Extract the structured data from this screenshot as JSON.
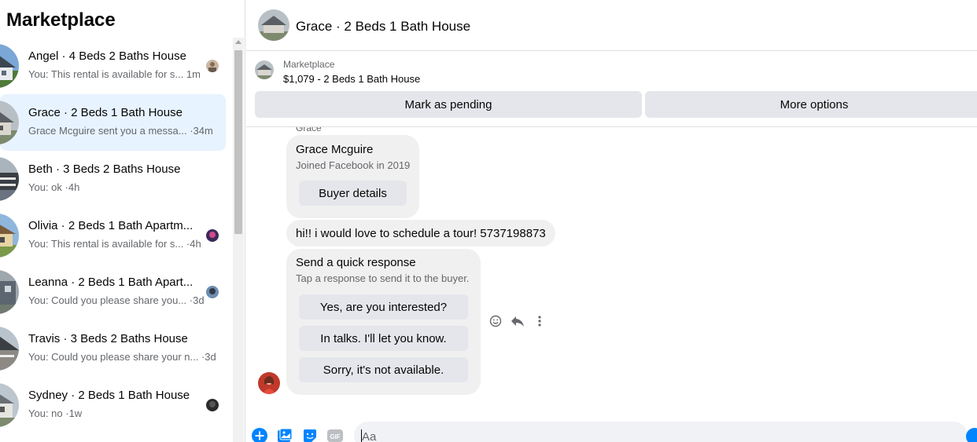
{
  "sidebar": {
    "title": "Marketplace",
    "conversations": [
      {
        "title": "Angel · 4 Beds 2 Baths House",
        "preview": "You: This rental is available for s...",
        "time": "1m",
        "active": false
      },
      {
        "title": "Grace · 2 Beds 1 Bath House",
        "preview": "Grace Mcguire sent you a messa...",
        "time": "·34m",
        "active": true
      },
      {
        "title": "Beth · 3 Beds 2 Baths House",
        "preview": "You: ok",
        "time": "·4h",
        "active": false
      },
      {
        "title": "Olivia · 2 Beds 1 Bath Apartm...",
        "preview": "You: This rental is available for s...",
        "time": "·4h",
        "active": false
      },
      {
        "title": "Leanna · 2 Beds 1 Bath Apart...",
        "preview": "You: Could you please share you...",
        "time": "·3d",
        "active": false
      },
      {
        "title": "Travis · 3 Beds 2 Baths House",
        "preview": "You: Could you please share your n...",
        "time": "·3d",
        "active": false
      },
      {
        "title": "Sydney · 2 Beds 1 Bath House",
        "preview": "You: no",
        "time": "·1w",
        "active": false
      }
    ]
  },
  "chat": {
    "header_title": "Grace · 2 Beds 1 Bath House",
    "listing": {
      "label": "Marketplace",
      "price_title": "$1,079 - 2 Beds 1 Bath House",
      "mark_pending": "Mark as pending",
      "more_options": "More options"
    },
    "sender_label": "Grace",
    "buyer_card": {
      "name": "Grace Mcguire",
      "joined": "Joined Facebook in 2019",
      "button": "Buyer details"
    },
    "message": "hi!! i would love to schedule a tour! 5737198873",
    "quick_response": {
      "title": "Send a quick response",
      "subtitle": "Tap a response to send it to the buyer.",
      "options": [
        "Yes, are you interested?",
        "In talks. I'll let you know.",
        "Sorry, it's not available."
      ]
    },
    "composer": {
      "placeholder": "Aa",
      "gif_label": "GIF"
    }
  },
  "colors": {
    "accent": "#0084ff",
    "active_row": "#e7f3ff",
    "bubble": "#f0f0f0",
    "button": "#e4e6eb"
  }
}
